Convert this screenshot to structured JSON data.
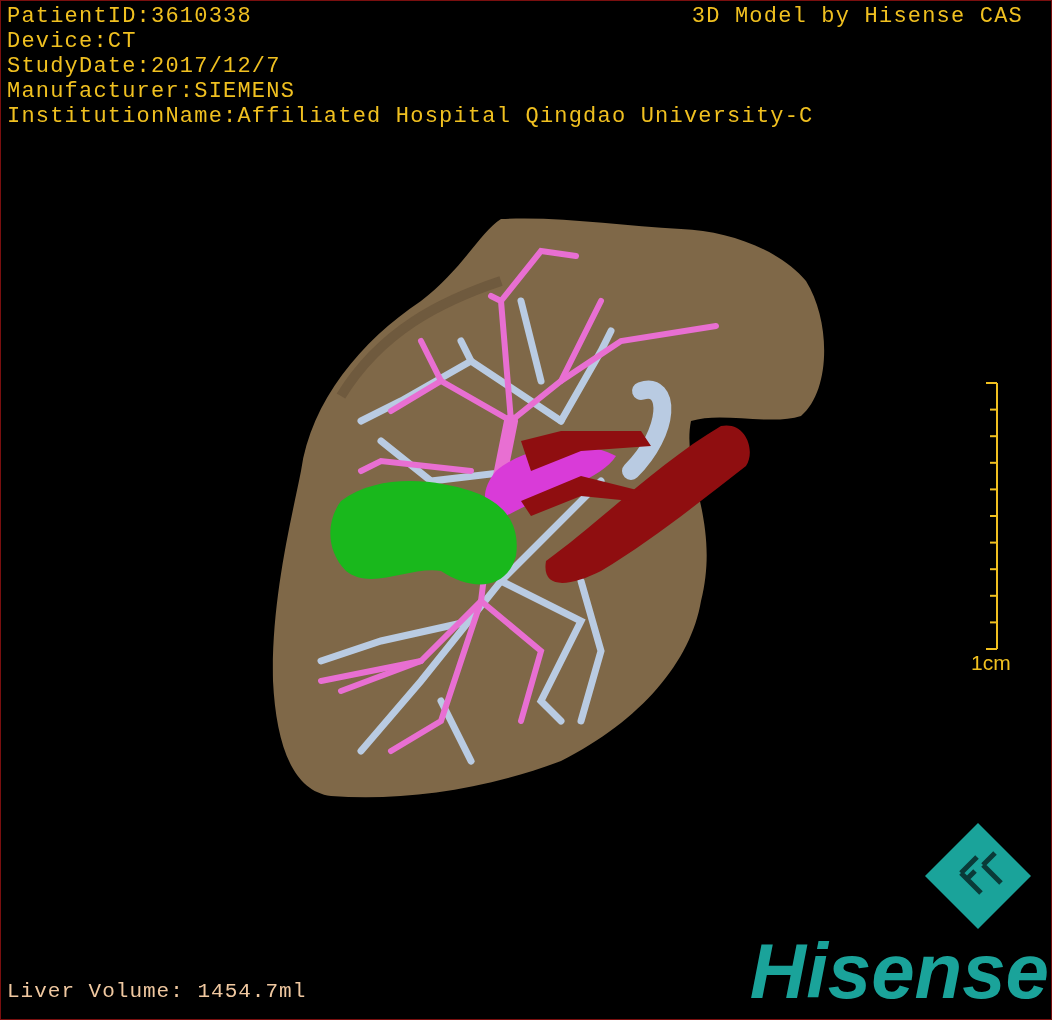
{
  "overlay": {
    "info_lines": [
      "PatientID:3610338",
      "Device:CT",
      "StudyDate:2017/12/7",
      "Manufacturer:SIEMENS",
      "InstitutionName:Affiliated Hospital Qingdao University-C"
    ],
    "credit": "3D Model by Hisense CAS",
    "scale_bar": {
      "label": "1cm"
    },
    "volume": "Liver Volume: 1454.7ml"
  },
  "logo": {
    "text": "Hisense"
  }
}
